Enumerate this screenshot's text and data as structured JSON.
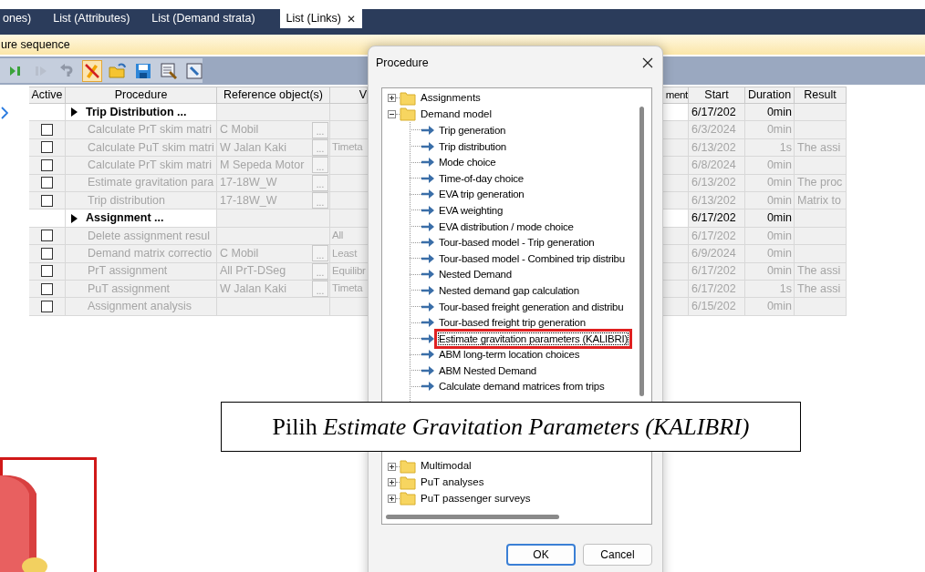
{
  "tabs": [
    {
      "label": "ones)",
      "selected": false
    },
    {
      "label": "List (Attributes)",
      "selected": false
    },
    {
      "label": "List (Demand strata)",
      "selected": false
    },
    {
      "label": "List (Links)",
      "selected": true,
      "close": "✕"
    }
  ],
  "panel_title": "ure sequence",
  "toolbar": [
    {
      "kind": "run",
      "on": false
    },
    {
      "kind": "step",
      "on": false
    },
    {
      "kind": "undo",
      "on": false
    },
    {
      "kind": "edit",
      "on": true
    },
    {
      "kind": "open",
      "on": false
    },
    {
      "kind": "save",
      "on": false
    },
    {
      "kind": "settings",
      "on": false
    },
    {
      "kind": "window",
      "on": false
    }
  ],
  "table": {
    "columns": [
      "Active",
      "Procedure",
      "Reference object(s)",
      "V",
      "ment",
      "Start",
      "Duration",
      "Result"
    ],
    "rows": [
      {
        "kind": "group",
        "current": true,
        "procedure": "Trip Distribution ...",
        "start": "6/17/202",
        "duration": "0min"
      },
      {
        "kind": "step",
        "active": false,
        "procedure": "Calculate PrT skim matri",
        "reference": "C Mobil",
        "ref_button": "...",
        "start": "6/3/2024",
        "duration": "0min"
      },
      {
        "kind": "step",
        "active": false,
        "procedure": "Calculate PuT skim matri",
        "reference": "W Jalan Kaki",
        "ref_button": "...",
        "v": "Timeta",
        "start": "6/13/202",
        "duration": "1s",
        "result": "The assi"
      },
      {
        "kind": "step",
        "active": false,
        "procedure": "Calculate PrT skim matri",
        "reference": "M Sepeda Motor",
        "ref_button": "...",
        "start": "6/8/2024",
        "duration": "0min"
      },
      {
        "kind": "step",
        "active": false,
        "procedure": "Estimate gravitation para",
        "reference": "17-18W_W",
        "ref_button": "...",
        "start": "6/13/202",
        "duration": "0min",
        "result": "The proc"
      },
      {
        "kind": "step",
        "active": false,
        "procedure": "Trip distribution",
        "reference": "17-18W_W",
        "ref_button": "...",
        "start": "6/13/202",
        "duration": "0min",
        "result": "Matrix to"
      },
      {
        "kind": "group",
        "current": false,
        "procedure": "Assignment ...",
        "start": "6/17/202",
        "duration": "0min"
      },
      {
        "kind": "step",
        "active": false,
        "procedure": "Delete assignment resul",
        "v": "All",
        "start": "6/17/202",
        "duration": "0min"
      },
      {
        "kind": "step",
        "active": false,
        "procedure": "Demand matrix correctio",
        "reference": "C Mobil",
        "ref_button": "...",
        "v": "Least",
        "start": "6/9/2024",
        "duration": "0min"
      },
      {
        "kind": "step",
        "active": false,
        "procedure": "PrT assignment",
        "reference": "All PrT-DSeg",
        "ref_button": "...",
        "v": "Equilibr",
        "start": "6/17/202",
        "duration": "0min",
        "result": "The assi"
      },
      {
        "kind": "step",
        "active": false,
        "procedure": "PuT assignment",
        "reference": "W Jalan Kaki",
        "ref_button": "...",
        "v": "Timeta",
        "start": "6/17/202",
        "duration": "1s",
        "result": "The assi"
      },
      {
        "kind": "step",
        "active": false,
        "procedure": "Assignment analysis",
        "start": "6/15/202",
        "duration": "0min"
      }
    ]
  },
  "dialog": {
    "title": "Procedure",
    "tree": [
      {
        "label": "Assignments",
        "expanded": false
      },
      {
        "label": "Demand model",
        "expanded": true,
        "children": [
          {
            "label": "Trip generation",
            "selected": false,
            "highlighted": false
          },
          {
            "label": "Trip distribution",
            "selected": false,
            "highlighted": false
          },
          {
            "label": "Mode choice",
            "selected": false,
            "highlighted": false
          },
          {
            "label": "Time-of-day choice",
            "selected": false,
            "highlighted": false
          },
          {
            "label": "EVA trip generation",
            "selected": false,
            "highlighted": false
          },
          {
            "label": "EVA weighting",
            "selected": false,
            "highlighted": false
          },
          {
            "label": "EVA distribution / mode choice",
            "selected": false,
            "highlighted": false
          },
          {
            "label": "Tour-based model - Trip generation",
            "selected": false,
            "highlighted": false
          },
          {
            "label": "Tour-based model - Combined trip distribu",
            "selected": false,
            "highlighted": false
          },
          {
            "label": "Nested Demand",
            "selected": false,
            "highlighted": false
          },
          {
            "label": "Nested demand gap calculation",
            "selected": false,
            "highlighted": false
          },
          {
            "label": "Tour-based freight generation and distribu",
            "selected": false,
            "highlighted": false
          },
          {
            "label": "Tour-based freight trip generation",
            "selected": false,
            "highlighted": false
          },
          {
            "label": "Estimate gravitation parameters (KALIBRI)",
            "selected": true,
            "highlighted": true
          },
          {
            "label": "ABM long-term location choices",
            "selected": false,
            "highlighted": false
          },
          {
            "label": "ABM Nested Demand",
            "selected": false,
            "highlighted": false
          },
          {
            "label": "Calculate demand matrices from trips",
            "selected": false,
            "highlighted": false
          }
        ]
      },
      {
        "label": "Multimodal",
        "expanded": false
      },
      {
        "label": "PuT analyses",
        "expanded": false
      },
      {
        "label": "PuT passenger surveys",
        "expanded": false
      }
    ],
    "buttons": [
      {
        "label": "OK",
        "default": true
      },
      {
        "label": "Cancel",
        "default": false
      }
    ]
  },
  "annotation": {
    "text": "Pilih *Estimate Gravitation Parameters (KALIBRI)*"
  }
}
